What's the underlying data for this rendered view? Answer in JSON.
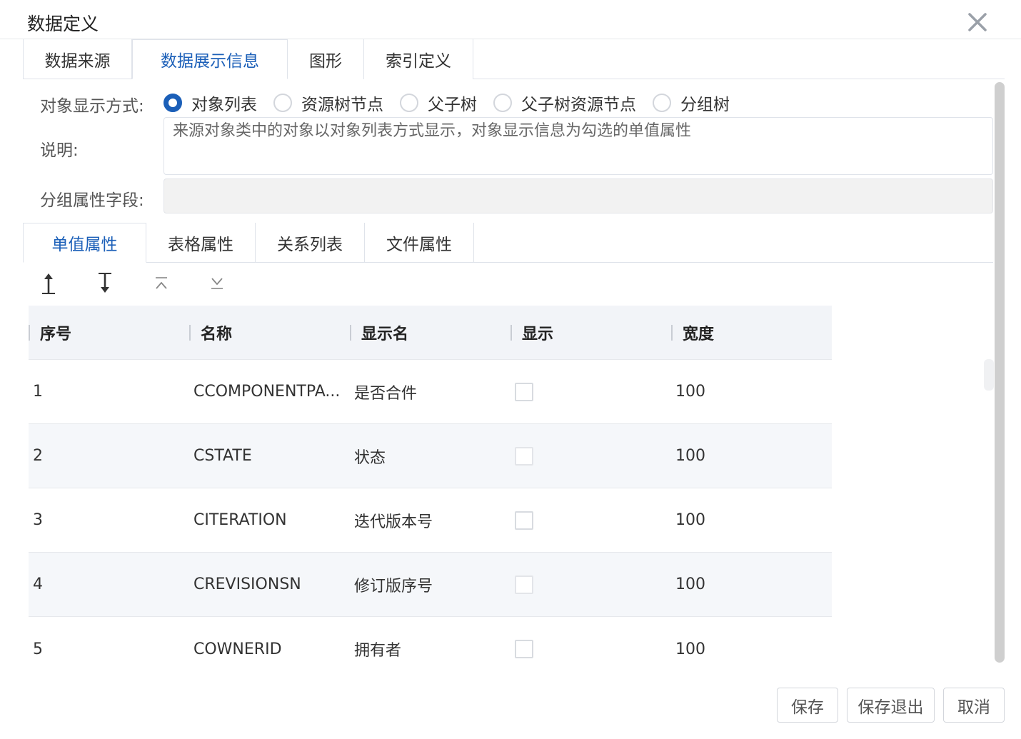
{
  "dialog": {
    "title": "数据定义",
    "close_icon": "close-icon"
  },
  "main_tabs": [
    {
      "label": "数据来源",
      "active": false
    },
    {
      "label": "数据展示信息",
      "active": true
    },
    {
      "label": "图形",
      "active": false
    },
    {
      "label": "索引定义",
      "active": false
    }
  ],
  "display_mode": {
    "label": "对象显示方式:",
    "options": [
      {
        "label": "对象列表",
        "checked": true
      },
      {
        "label": "资源树节点",
        "checked": false
      },
      {
        "label": "父子树",
        "checked": false
      },
      {
        "label": "父子树资源节点",
        "checked": false
      },
      {
        "label": "分组树",
        "checked": false
      }
    ]
  },
  "description": {
    "label": "说明:",
    "value": "来源对象类中的对象以对象列表方式显示，对象显示信息为勾选的单值属性"
  },
  "group_field": {
    "label": "分组属性字段:",
    "value": ""
  },
  "sub_tabs": [
    {
      "label": "单值属性",
      "active": true
    },
    {
      "label": "表格属性",
      "active": false
    },
    {
      "label": "关系列表",
      "active": false
    },
    {
      "label": "文件属性",
      "active": false
    }
  ],
  "toolbar": {
    "icons": [
      "move-up-icon",
      "move-down-icon",
      "move-top-icon",
      "move-bottom-icon"
    ]
  },
  "table": {
    "columns": [
      "序号",
      "名称",
      "显示名",
      "显示",
      "宽度"
    ],
    "rows": [
      {
        "index": "1",
        "name": "CCOMPONENTPA...",
        "display_name": "是否合件",
        "shown": false,
        "width": "100"
      },
      {
        "index": "2",
        "name": "CSTATE",
        "display_name": "状态",
        "shown": false,
        "width": "100"
      },
      {
        "index": "3",
        "name": "CITERATION",
        "display_name": "迭代版本号",
        "shown": false,
        "width": "100"
      },
      {
        "index": "4",
        "name": "CREVISIONSN",
        "display_name": "修订版序号",
        "shown": false,
        "width": "100"
      },
      {
        "index": "5",
        "name": "COWNERID",
        "display_name": "拥有者",
        "shown": false,
        "width": "100"
      }
    ]
  },
  "buttons": {
    "save": "保存",
    "save_exit": "保存退出",
    "cancel": "取消"
  },
  "colors": {
    "accent": "#1b5fb8",
    "header_bg": "#f2f4f8",
    "alt_row_bg": "#f5f7fa"
  }
}
